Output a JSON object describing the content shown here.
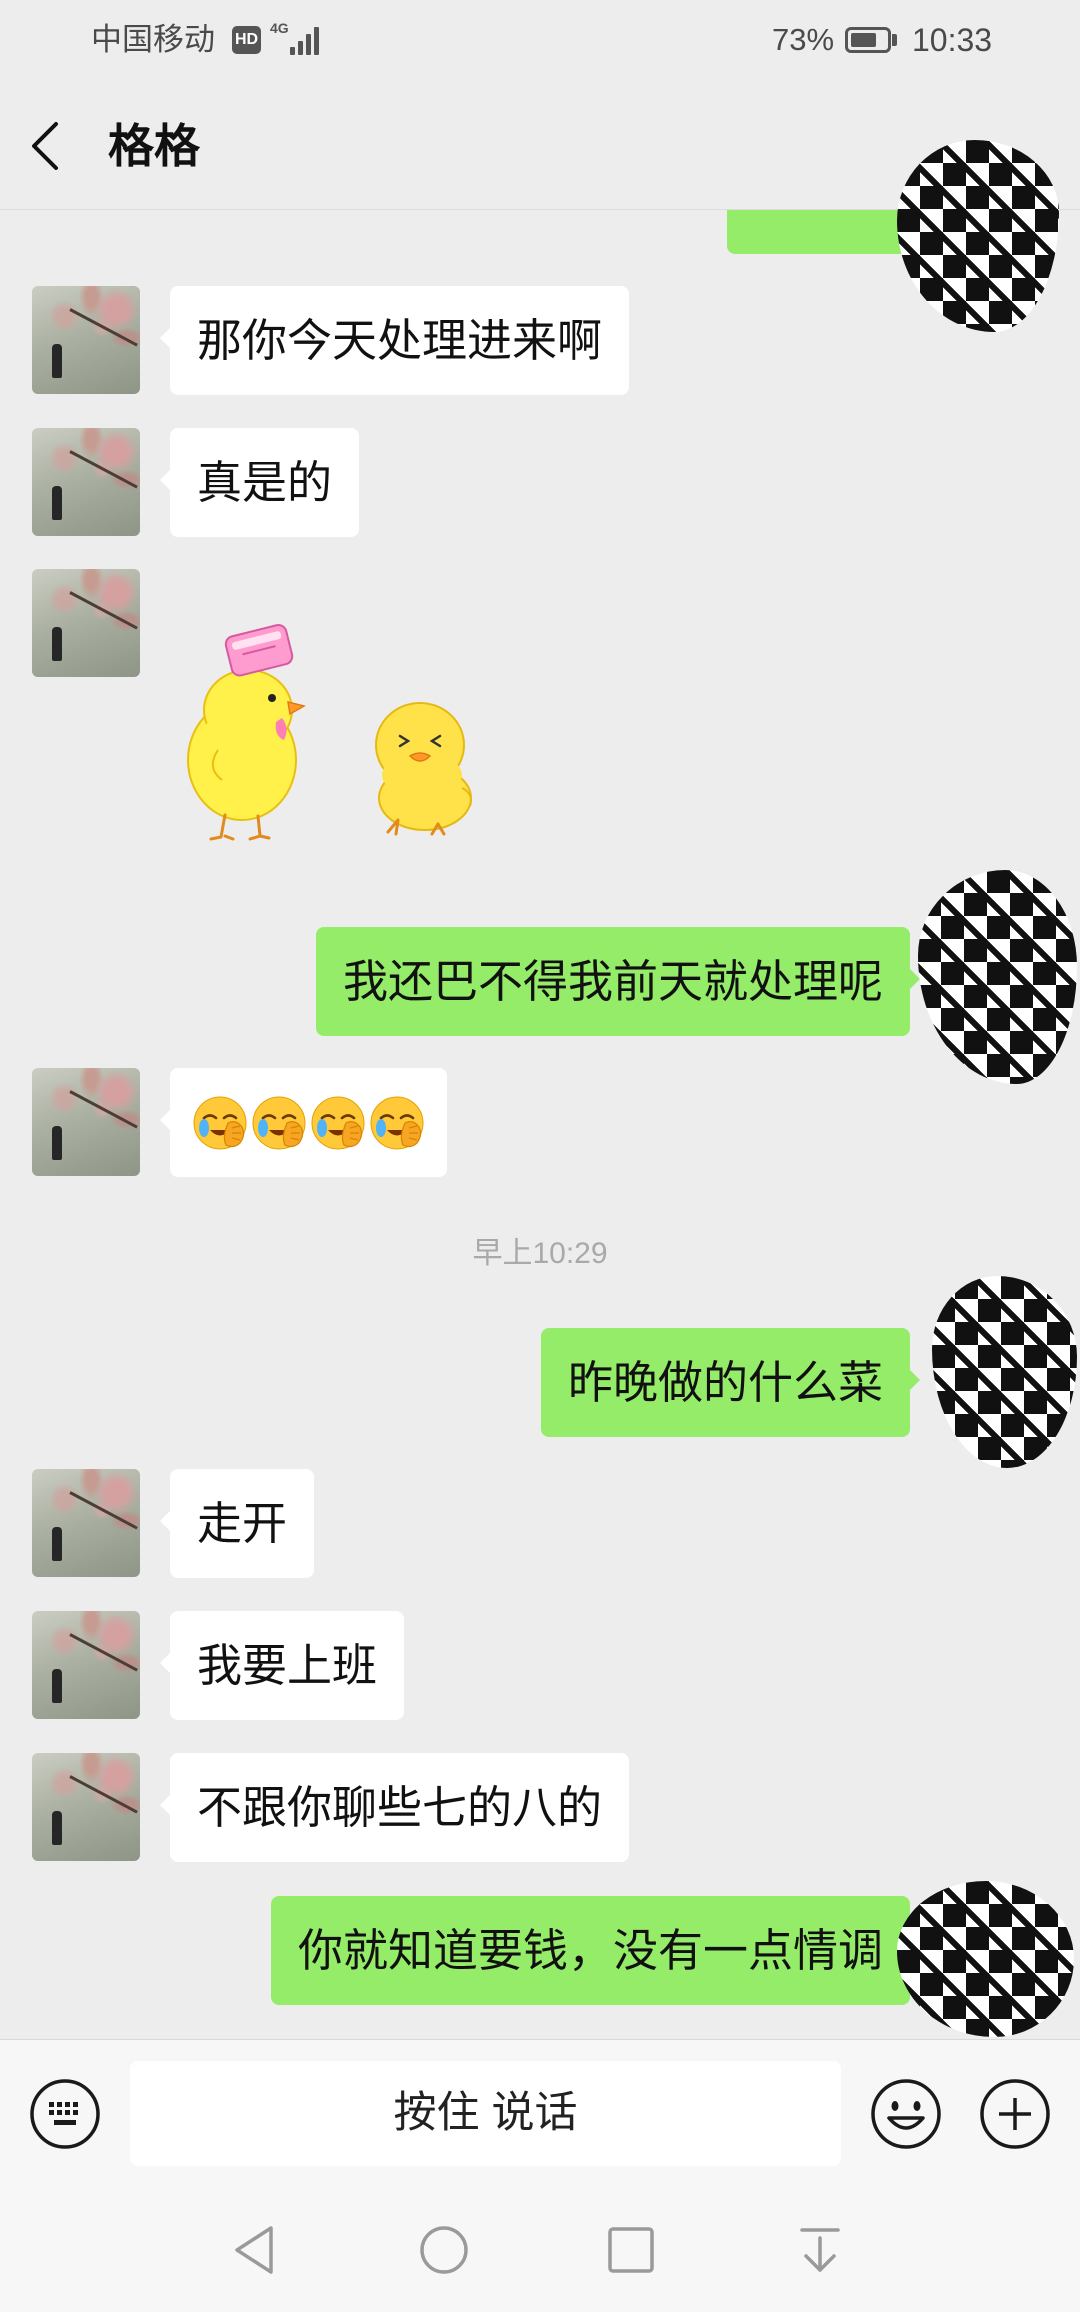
{
  "status_bar": {
    "carrier": "中国移动",
    "hd_badge": "HD",
    "network": "4G",
    "battery_percent": "73%",
    "battery_level": 0.73,
    "time": "10:33"
  },
  "header": {
    "title": "格格",
    "back_icon": "chevron-left-icon"
  },
  "messages": [
    {
      "from": "me",
      "text": ""
    },
    {
      "from": "contact",
      "text": "那你今天处理进来啊"
    },
    {
      "from": "contact",
      "text": "真是的"
    },
    {
      "from": "contact",
      "sticker": "two-yellow-chicks-sticker"
    },
    {
      "from": "me",
      "text": "我还巴不得我前天就处理呢"
    },
    {
      "from": "contact",
      "emojis": [
        "facepalm-emoji",
        "facepalm-emoji",
        "facepalm-emoji",
        "facepalm-emoji"
      ]
    },
    {
      "type": "time",
      "text": "早上10:29"
    },
    {
      "from": "me",
      "text": "昨晚做的什么菜"
    },
    {
      "from": "contact",
      "text": "走开"
    },
    {
      "from": "contact",
      "text": "我要上班"
    },
    {
      "from": "contact",
      "text": "不跟你聊些七的八的"
    },
    {
      "from": "me",
      "text": "你就知道要钱，没有一点情调"
    }
  ],
  "input_bar": {
    "voice_button_label": "按住 说话",
    "left_icon": "keyboard-icon",
    "emoji_icon": "smiley-icon",
    "more_icon": "plus-circle-icon"
  },
  "nav_bar": {
    "icons": [
      "nav-back-icon",
      "nav-home-icon",
      "nav-recents-icon",
      "nav-hide-icon"
    ]
  },
  "colors": {
    "chat_background": "#ededed",
    "outgoing_bubble": "#95ec69",
    "incoming_bubble": "#ffffff",
    "timestamp_text": "#a9a9a9"
  }
}
